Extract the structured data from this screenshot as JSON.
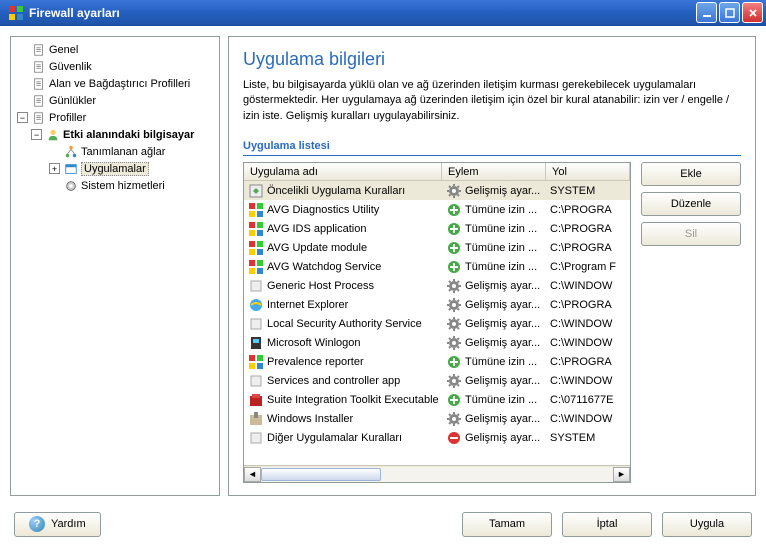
{
  "window": {
    "title": "Firewall ayarları"
  },
  "tree": {
    "items": [
      {
        "label": "Genel",
        "indent": 0,
        "exp": "",
        "icon": "doc-icon"
      },
      {
        "label": "Güvenlik",
        "indent": 0,
        "exp": "",
        "icon": "doc-icon"
      },
      {
        "label": "Alan ve Bağdaştırıcı Profilleri",
        "indent": 0,
        "exp": "",
        "icon": "doc-icon"
      },
      {
        "label": "Günlükler",
        "indent": 0,
        "exp": "",
        "icon": "doc-icon"
      },
      {
        "label": "Profiller",
        "indent": 0,
        "exp": "-",
        "icon": "doc-icon"
      },
      {
        "label": "Etki alanındaki bilgisayar",
        "indent": 1,
        "exp": "-",
        "icon": "user-icon",
        "bold": true
      },
      {
        "label": "Tanımlanan ağlar",
        "indent": 2,
        "exp": "",
        "icon": "net-icon"
      },
      {
        "label": "Uygulamalar",
        "indent": 2,
        "exp": "+",
        "icon": "app-icon",
        "selected": true
      },
      {
        "label": "Sistem hizmetleri",
        "indent": 2,
        "exp": "",
        "icon": "svc-icon"
      }
    ]
  },
  "main": {
    "title": "Uygulama bilgileri",
    "desc": "Liste, bu bilgisayarda yüklü olan ve ağ üzerinden iletişim kurması gerekebilecek uygulamaları göstermektedir. Her uygulamaya ağ üzerinden iletişim için özel bir kural atanabilir: izin ver / engelle / izin iste. Gelişmiş kuralları uygulayabilirsiniz.",
    "section": "Uygulama listesi",
    "columns": {
      "app": "Uygulama adı",
      "action": "Eylem",
      "path": "Yol"
    },
    "rows": [
      {
        "name": "Öncelikli Uygulama Kuralları",
        "action": "Gelişmiş ayar...",
        "path": "SYSTEM",
        "icon": "prio-icon",
        "aicon": "gear-icon",
        "selected": true
      },
      {
        "name": "AVG Diagnostics Utility",
        "action": "Tümüne izin ...",
        "path": "C:\\PROGRA",
        "icon": "avg-red-icon",
        "aicon": "allow-icon"
      },
      {
        "name": "AVG IDS application",
        "action": "Tümüne izin ...",
        "path": "C:\\PROGRA",
        "icon": "avg-red-icon",
        "aicon": "allow-icon"
      },
      {
        "name": "AVG Update module",
        "action": "Tümüne izin ...",
        "path": "C:\\PROGRA",
        "icon": "avg-grn-icon",
        "aicon": "allow-icon"
      },
      {
        "name": "AVG Watchdog Service",
        "action": "Tümüne izin ...",
        "path": "C:\\Program F",
        "icon": "avg-grn-icon",
        "aicon": "allow-icon"
      },
      {
        "name": "Generic Host Process",
        "action": "Gelişmiş ayar...",
        "path": "C:\\WINDOW",
        "icon": "generic-icon",
        "aicon": "gear-icon"
      },
      {
        "name": "Internet Explorer",
        "action": "Gelişmiş ayar...",
        "path": "C:\\PROGRA",
        "icon": "ie-icon",
        "aicon": "gear-icon"
      },
      {
        "name": "Local Security Authority Service",
        "action": "Gelişmiş ayar...",
        "path": "C:\\WINDOW",
        "icon": "generic-icon",
        "aicon": "gear-icon"
      },
      {
        "name": "Microsoft Winlogon",
        "action": "Gelişmiş ayar...",
        "path": "C:\\WINDOW",
        "icon": "winlogon-icon",
        "aicon": "gear-icon"
      },
      {
        "name": "Prevalence reporter",
        "action": "Tümüne izin ...",
        "path": "C:\\PROGRA",
        "icon": "avg-red-icon",
        "aicon": "allow-icon"
      },
      {
        "name": "Services and controller app",
        "action": "Gelişmiş ayar...",
        "path": "C:\\WINDOW",
        "icon": "generic-icon",
        "aicon": "gear-icon"
      },
      {
        "name": "Suite Integration Toolkit Executable",
        "action": "Tümüne izin ...",
        "path": "C:\\0711677E",
        "icon": "suite-icon",
        "aicon": "allow-icon"
      },
      {
        "name": "Windows Installer",
        "action": "Gelişmiş ayar...",
        "path": "C:\\WINDOW",
        "icon": "msi-icon",
        "aicon": "gear-icon"
      },
      {
        "name": "Diğer Uygulamalar Kuralları",
        "action": "Gelişmiş ayar...",
        "path": "SYSTEM",
        "icon": "",
        "aicon": "block-icon"
      }
    ],
    "buttons": {
      "add": "Ekle",
      "edit": "Düzenle",
      "delete": "Sil"
    }
  },
  "footer": {
    "help": "Yardım",
    "ok": "Tamam",
    "cancel": "İptal",
    "apply": "Uygula"
  }
}
